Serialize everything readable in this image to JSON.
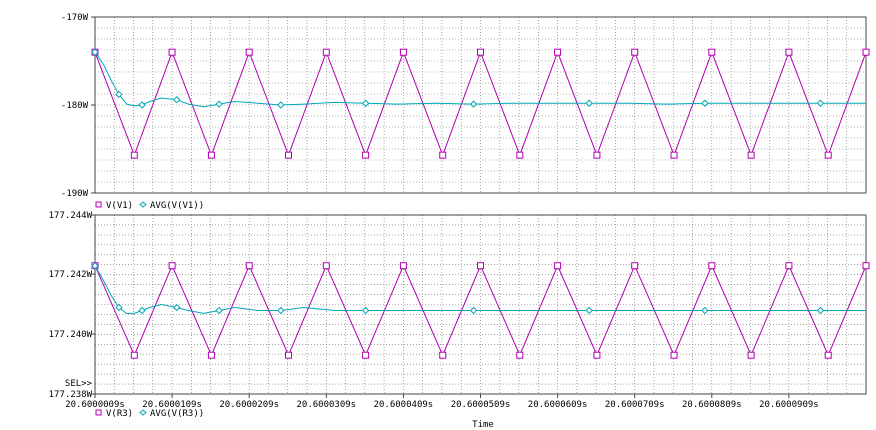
{
  "chart_data": [
    {
      "type": "line",
      "y_tick_labels": [
        "-170W",
        "-180W",
        "-190W"
      ],
      "ylim": [
        -190,
        -170
      ],
      "grid": true,
      "legend": [
        "V(V1)",
        "AVG(V(V1))"
      ],
      "legend_placement": "below-plot",
      "series": [
        {
          "name": "V(V1)",
          "color": "#b000b0",
          "marker": "square",
          "x": [
            20.6000009,
            20.600006,
            20.6000109,
            20.600016,
            20.6000209,
            20.600026,
            20.6000309,
            20.600036,
            20.6000409,
            20.600046,
            20.6000509,
            20.600056,
            20.6000609,
            20.600066,
            20.6000709,
            20.600076,
            20.6000809,
            20.600086,
            20.6000909,
            20.600096,
            20.6001009
          ],
          "values": [
            -174,
            -185.7,
            -174,
            -185.7,
            -174,
            -185.7,
            -174,
            -185.7,
            -174,
            -185.7,
            -174,
            -185.7,
            -174,
            -185.7,
            -174,
            -185.7,
            -174,
            -185.7,
            -174,
            -185.7,
            -174
          ]
        },
        {
          "name": "AVG(V(V1))",
          "color": "#00a8b8",
          "marker": "diamond",
          "x": [
            20.6000009,
            20.600002,
            20.600003,
            20.600004,
            20.600005,
            20.600006,
            20.600007,
            20.600008,
            20.6000095,
            20.6000115,
            20.600013,
            20.600015,
            20.600017,
            20.600019,
            20.600022,
            20.600025,
            20.600028,
            20.600032,
            20.600036,
            20.60004,
            20.600045,
            20.60005,
            20.600055,
            20.60006,
            20.600065,
            20.60007,
            20.600075,
            20.60008,
            20.600085,
            20.60009,
            20.600095,
            20.6001009
          ],
          "values": [
            -174,
            -175.4,
            -177.2,
            -178.8,
            -179.9,
            -180.1,
            -180,
            -179.6,
            -179.2,
            -179.4,
            -179.9,
            -180.2,
            -179.9,
            -179.6,
            -179.8,
            -180,
            -179.9,
            -179.7,
            -179.8,
            -179.9,
            -179.8,
            -179.9,
            -179.8,
            -179.8,
            -179.8,
            -179.8,
            -179.9,
            -179.8,
            -179.8,
            -179.8,
            -179.8,
            -179.8
          ]
        }
      ]
    },
    {
      "type": "line",
      "y_tick_labels": [
        "177.244W",
        "177.242W",
        "177.240W",
        "177.238W"
      ],
      "ylim": [
        177.238,
        177.244
      ],
      "grid": true,
      "legend": [
        "V(R3)",
        "AVG(V(R3))"
      ],
      "legend_placement": "below-plot",
      "sel_marker": "SEL>>",
      "series": [
        {
          "name": "V(R3)",
          "color": "#b000b0",
          "marker": "square",
          "x": [
            20.6000009,
            20.600006,
            20.6000109,
            20.600016,
            20.6000209,
            20.600026,
            20.6000309,
            20.600036,
            20.6000409,
            20.600046,
            20.6000509,
            20.600056,
            20.6000609,
            20.600066,
            20.6000709,
            20.600076,
            20.6000809,
            20.600086,
            20.6000909,
            20.600096,
            20.6001009
          ],
          "values": [
            177.2423,
            177.2393,
            177.2423,
            177.2393,
            177.2423,
            177.2393,
            177.2423,
            177.2393,
            177.2423,
            177.2393,
            177.2423,
            177.2393,
            177.2423,
            177.2393,
            177.2423,
            177.2393,
            177.2423,
            177.2393,
            177.2423,
            177.2393,
            177.2423
          ]
        },
        {
          "name": "AVG(V(R3))",
          "color": "#00a8b8",
          "marker": "diamond",
          "x": [
            20.6000009,
            20.600002,
            20.600003,
            20.600004,
            20.600005,
            20.600006,
            20.600007,
            20.600008,
            20.6000095,
            20.6000115,
            20.600013,
            20.600015,
            20.600017,
            20.600019,
            20.600022,
            20.600025,
            20.600028,
            20.600032,
            20.600036,
            20.60004,
            20.600045,
            20.60005,
            20.600055,
            20.60006,
            20.600065,
            20.60007,
            20.600075,
            20.60008,
            20.600085,
            20.60009,
            20.600095,
            20.6001009
          ],
          "values": [
            177.2423,
            177.2418,
            177.2413,
            177.2409,
            177.2407,
            177.2407,
            177.2408,
            177.2409,
            177.241,
            177.2409,
            177.2408,
            177.2407,
            177.2408,
            177.2409,
            177.2408,
            177.2408,
            177.2409,
            177.2408,
            177.2408,
            177.2408,
            177.2408,
            177.2408,
            177.2408,
            177.2408,
            177.2408,
            177.2408,
            177.2408,
            177.2408,
            177.2408,
            177.2408,
            177.2408,
            177.2408
          ]
        }
      ]
    }
  ],
  "x_axis": {
    "label": "Time",
    "range": [
      20.6000009,
      20.6001009
    ],
    "tick_values": [
      20.6000009,
      20.6000109,
      20.6000209,
      20.6000309,
      20.6000409,
      20.6000509,
      20.6000609,
      20.6000709,
      20.6000809,
      20.6000909
    ],
    "tick_labels": [
      "20.6000009s",
      "20.6000109s",
      "20.6000209s",
      "20.6000309s",
      "20.6000409s",
      "20.6000509s",
      "20.6000609s",
      "20.6000709s",
      "20.6000809s",
      "20.6000909s"
    ]
  },
  "colors": {
    "grid": "#6e6e6e",
    "axis": "#444444"
  }
}
